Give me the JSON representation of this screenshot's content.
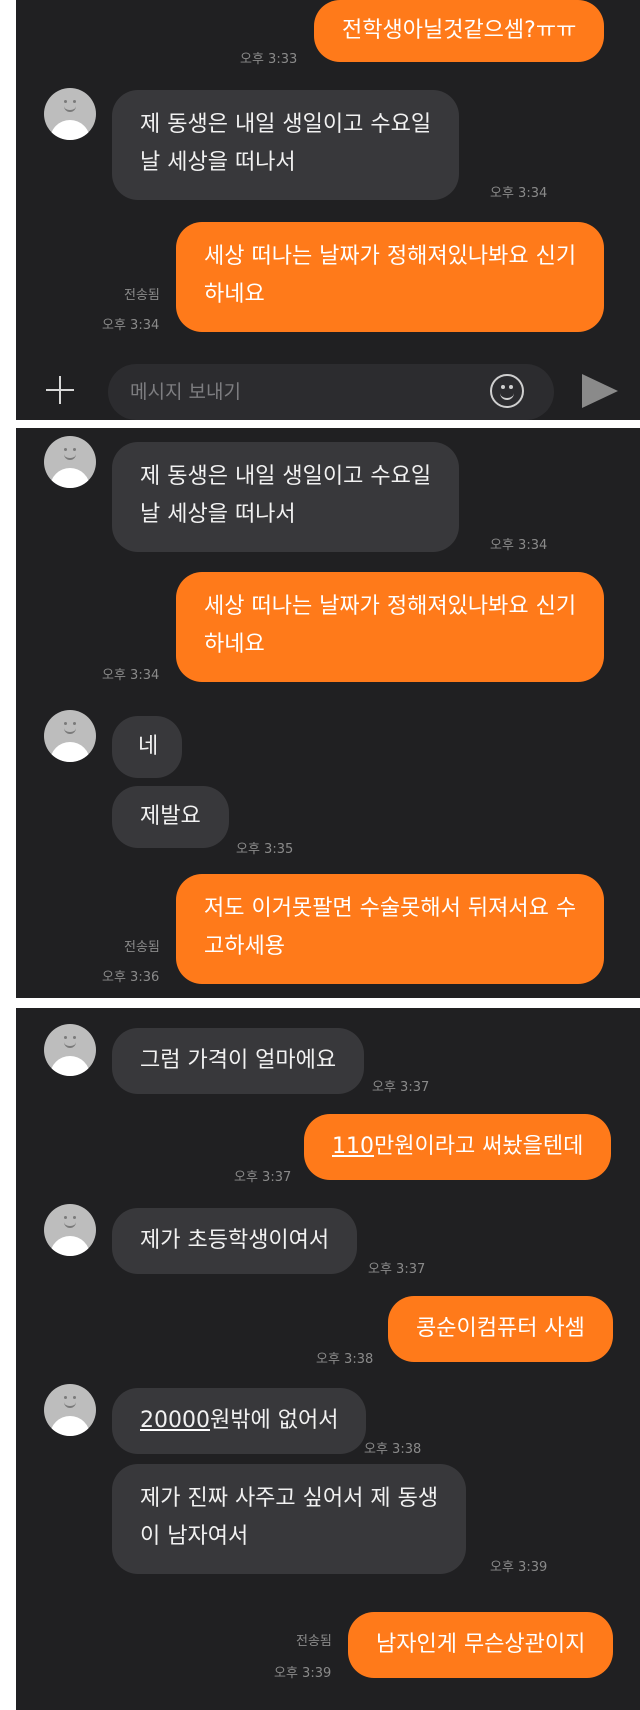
{
  "panel1": {
    "m1_text": "전학생아닐것같으셈?ㅠㅠ",
    "m1_time": "오후 3:33",
    "m2_line1": "제 동생은 내일 생일이고 수요일",
    "m2_line2": "날 세상을 떠나서",
    "m2_time": "오후 3:34",
    "m3_line1": "세상 떠나는 날짜가 정해져있나봐요 신기",
    "m3_line2": "하네요",
    "m3_read": "전송됨",
    "m3_time": "오후 3:34",
    "composer_placeholder": "메시지 보내기"
  },
  "panel2": {
    "m1_line1": "제 동생은 내일 생일이고 수요일",
    "m1_line2": "날 세상을 떠나서",
    "m1_time": "오후 3:34",
    "m2_line1": "세상 떠나는 날짜가 정해져있나봐요 신기",
    "m2_line2": "하네요",
    "m2_time": "오후 3:34",
    "m3_text": "네",
    "m4_text": "제발요",
    "m4_time": "오후 3:35",
    "m5_line1": "저도 이거못팔면 수술못해서 뒤져서요 수",
    "m5_line2": "고하세용",
    "m5_read": "전송됨",
    "m5_time": "오후 3:36"
  },
  "panel3": {
    "m1_text": "그럼 가격이 얼마에요",
    "m1_time": "오후 3:37",
    "m2_underlined": "110",
    "m2_rest": "만원이라고 써놨을텐데",
    "m2_time": "오후 3:37",
    "m3_text": "제가 초등학생이여서",
    "m3_time": "오후 3:37",
    "m4_text": "콩순이컴퓨터 사셈",
    "m4_time": "오후 3:38",
    "m5_underlined": "20000",
    "m5_rest": "원밖에 없어서",
    "m5_time": "오후 3:38",
    "m6_line1": "제가 진짜 사주고 싶어서 제 동생",
    "m6_line2": "이 남자여서",
    "m6_time": "오후 3:39",
    "m7_text": "남자인게 무슨상관이지",
    "m7_read": "전송됨",
    "m7_time": "오후 3:39"
  },
  "colors": {
    "sent_bubble": "#ff7a1a",
    "received_bubble": "#38383b",
    "background": "#202022"
  }
}
